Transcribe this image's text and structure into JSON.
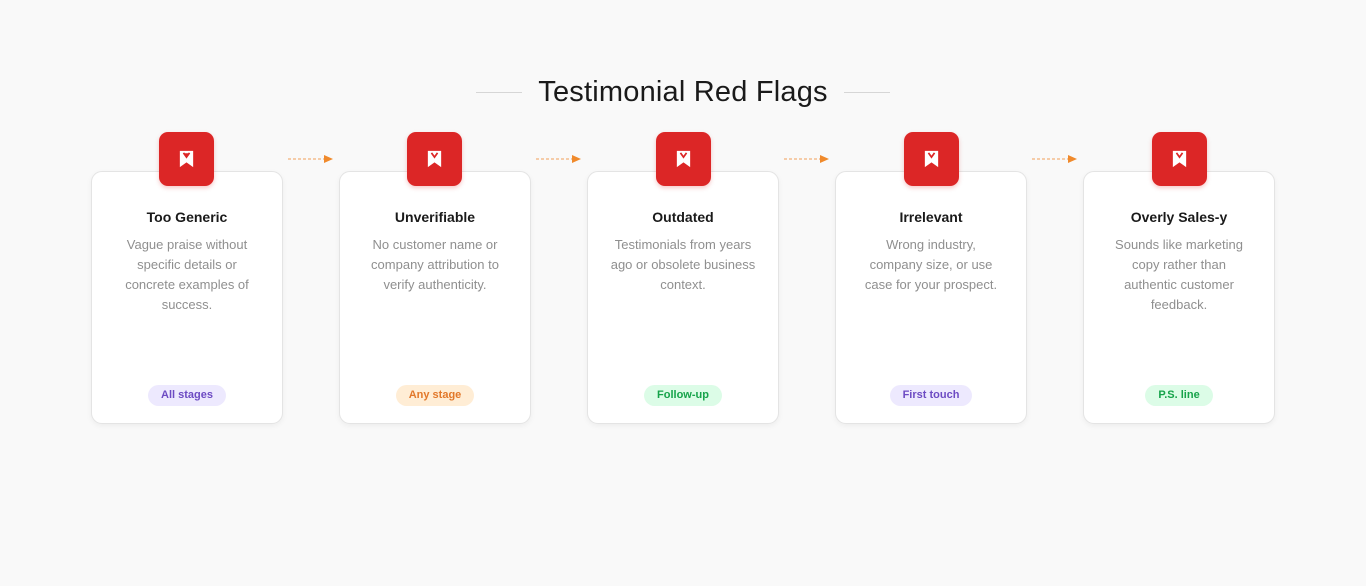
{
  "header": {
    "title": "Testimonial Red Flags"
  },
  "cards": [
    {
      "title": "Too Generic",
      "description": "Vague praise without specific details or concrete examples of success.",
      "badge": "All stages",
      "icon": "bookmark-icon"
    },
    {
      "title": "Unverifiable",
      "description": "No customer name or company attribution to verify authenticity.",
      "badge": "Any stage",
      "icon": "bookmark-icon"
    },
    {
      "title": "Outdated",
      "description": "Testimonials from years ago or obsolete business context.",
      "badge": "Follow-up",
      "icon": "bookmark-icon"
    },
    {
      "title": "Irrelevant",
      "description": "Wrong industry, company size, or use case for your prospect.",
      "badge": "First touch",
      "icon": "bookmark-icon"
    },
    {
      "title": "Overly Sales-y",
      "description": "Sounds like marketing copy rather than authentic customer feedback.",
      "badge": "P.S. line",
      "icon": "bookmark-icon"
    }
  ],
  "colors": {
    "icon_background": "#dc2626",
    "arrow": "#f08a2c",
    "badge_purple": "#ede9fe",
    "badge_orange": "#ffedd5",
    "badge_green": "#dcfce7"
  }
}
